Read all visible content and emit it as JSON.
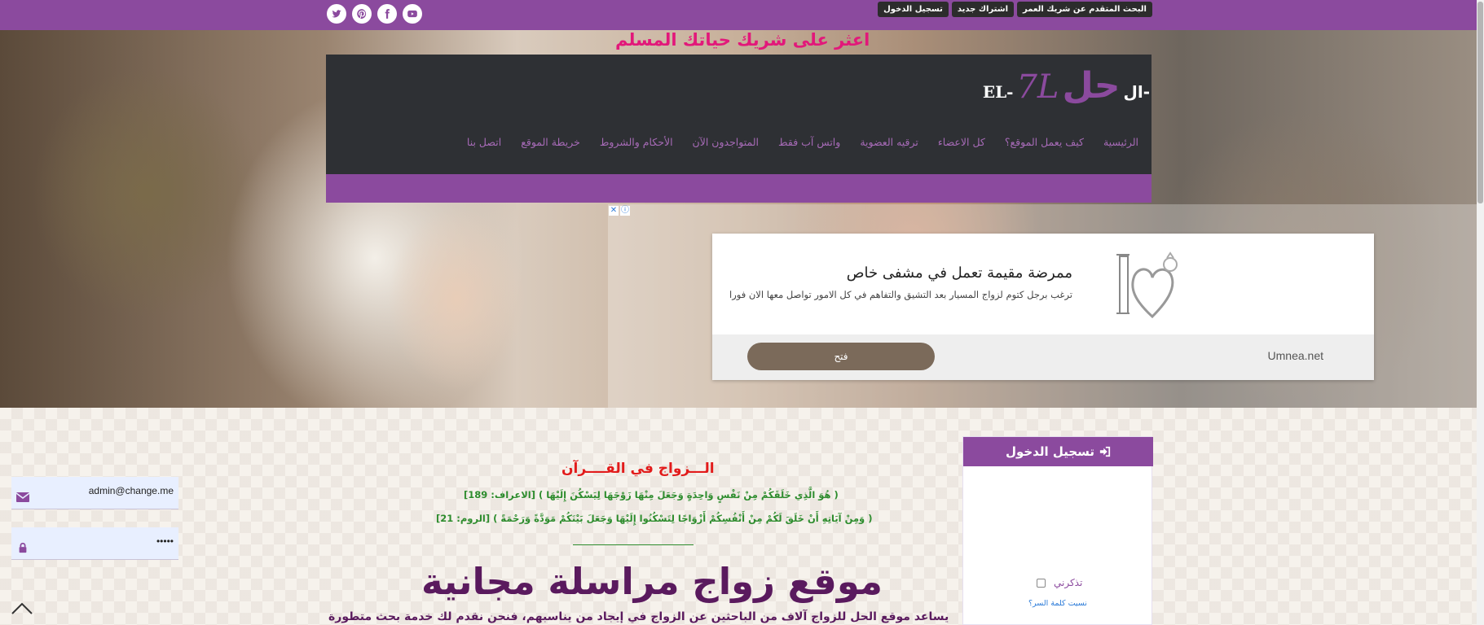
{
  "topbar": {
    "links": [
      "تسجيل الدخول",
      "اشتراك جديد",
      "البحث المتقدم عن شريك العمر"
    ],
    "socials": [
      "twitter-icon",
      "pinterest-icon",
      "facebook-icon",
      "youtube-icon"
    ],
    "color": "#8b4a9e"
  },
  "tagline": "اعثر على شريك حياتك المسلم",
  "logo": {
    "latin": "EL-",
    "latin_accent": "7L",
    "arabic": "حل",
    "arabic_prefix": "ال-"
  },
  "nav": {
    "items": [
      "الرئيسية",
      "كيف يعمل الموقع؟",
      "كل الاعضاء",
      "ترقيه العضوية",
      "واتس آب فقط",
      "المتواجدون الآن",
      "الأحكام والشروط",
      "خريطة الموقع",
      "اتصل بنا"
    ]
  },
  "ad": {
    "title": "ممرضة مقيمة تعمل في مشفى خاص",
    "description": "ترغب برجل كتوم لزواج المسيار بعد التشيق والتفاهم في كل الامور تواصل معها الان فورا",
    "domain": "Umnea.net",
    "button": "فتح"
  },
  "content": {
    "quran_title": "الـــزواج في القــــرآن",
    "verse1": "( هُوَ الَّذِي خَلَقَكُمْ مِنْ نَفْسٍ وَاحِدَةٍ وَجَعَلَ مِنْهَا زَوْجَهَا لِيَسْكُنَ إِلَيْهَا ) [الاعراف: 189]",
    "verse2": "( وَمِنْ آيَاتِهِ أَنْ خَلَقَ لَكُمْ مِنْ أَنْفُسِكُمْ أَزْوَاجًا لِتَسْكُنُوا إِلَيْهَا وَجَعَلَ بَيْنَكُمْ مَوَدَّةً وَرَحْمَةً ) [الروم: 21]",
    "heading": "موقع زواج مراسلة مجانية",
    "intro": "يساعد موقع الحل للزواج آلاف من الباحثين عن الزواج في إيجاد من يناسبهم، فنحن نقدم لك خدمة بحث متطورة"
  },
  "login": {
    "title": "تسجيل الدخول",
    "email_value": "admin@change.me",
    "password_value": "•••••",
    "remember_label": "تذكرني",
    "forgot_label": "نسيت كلمة السر؟"
  }
}
